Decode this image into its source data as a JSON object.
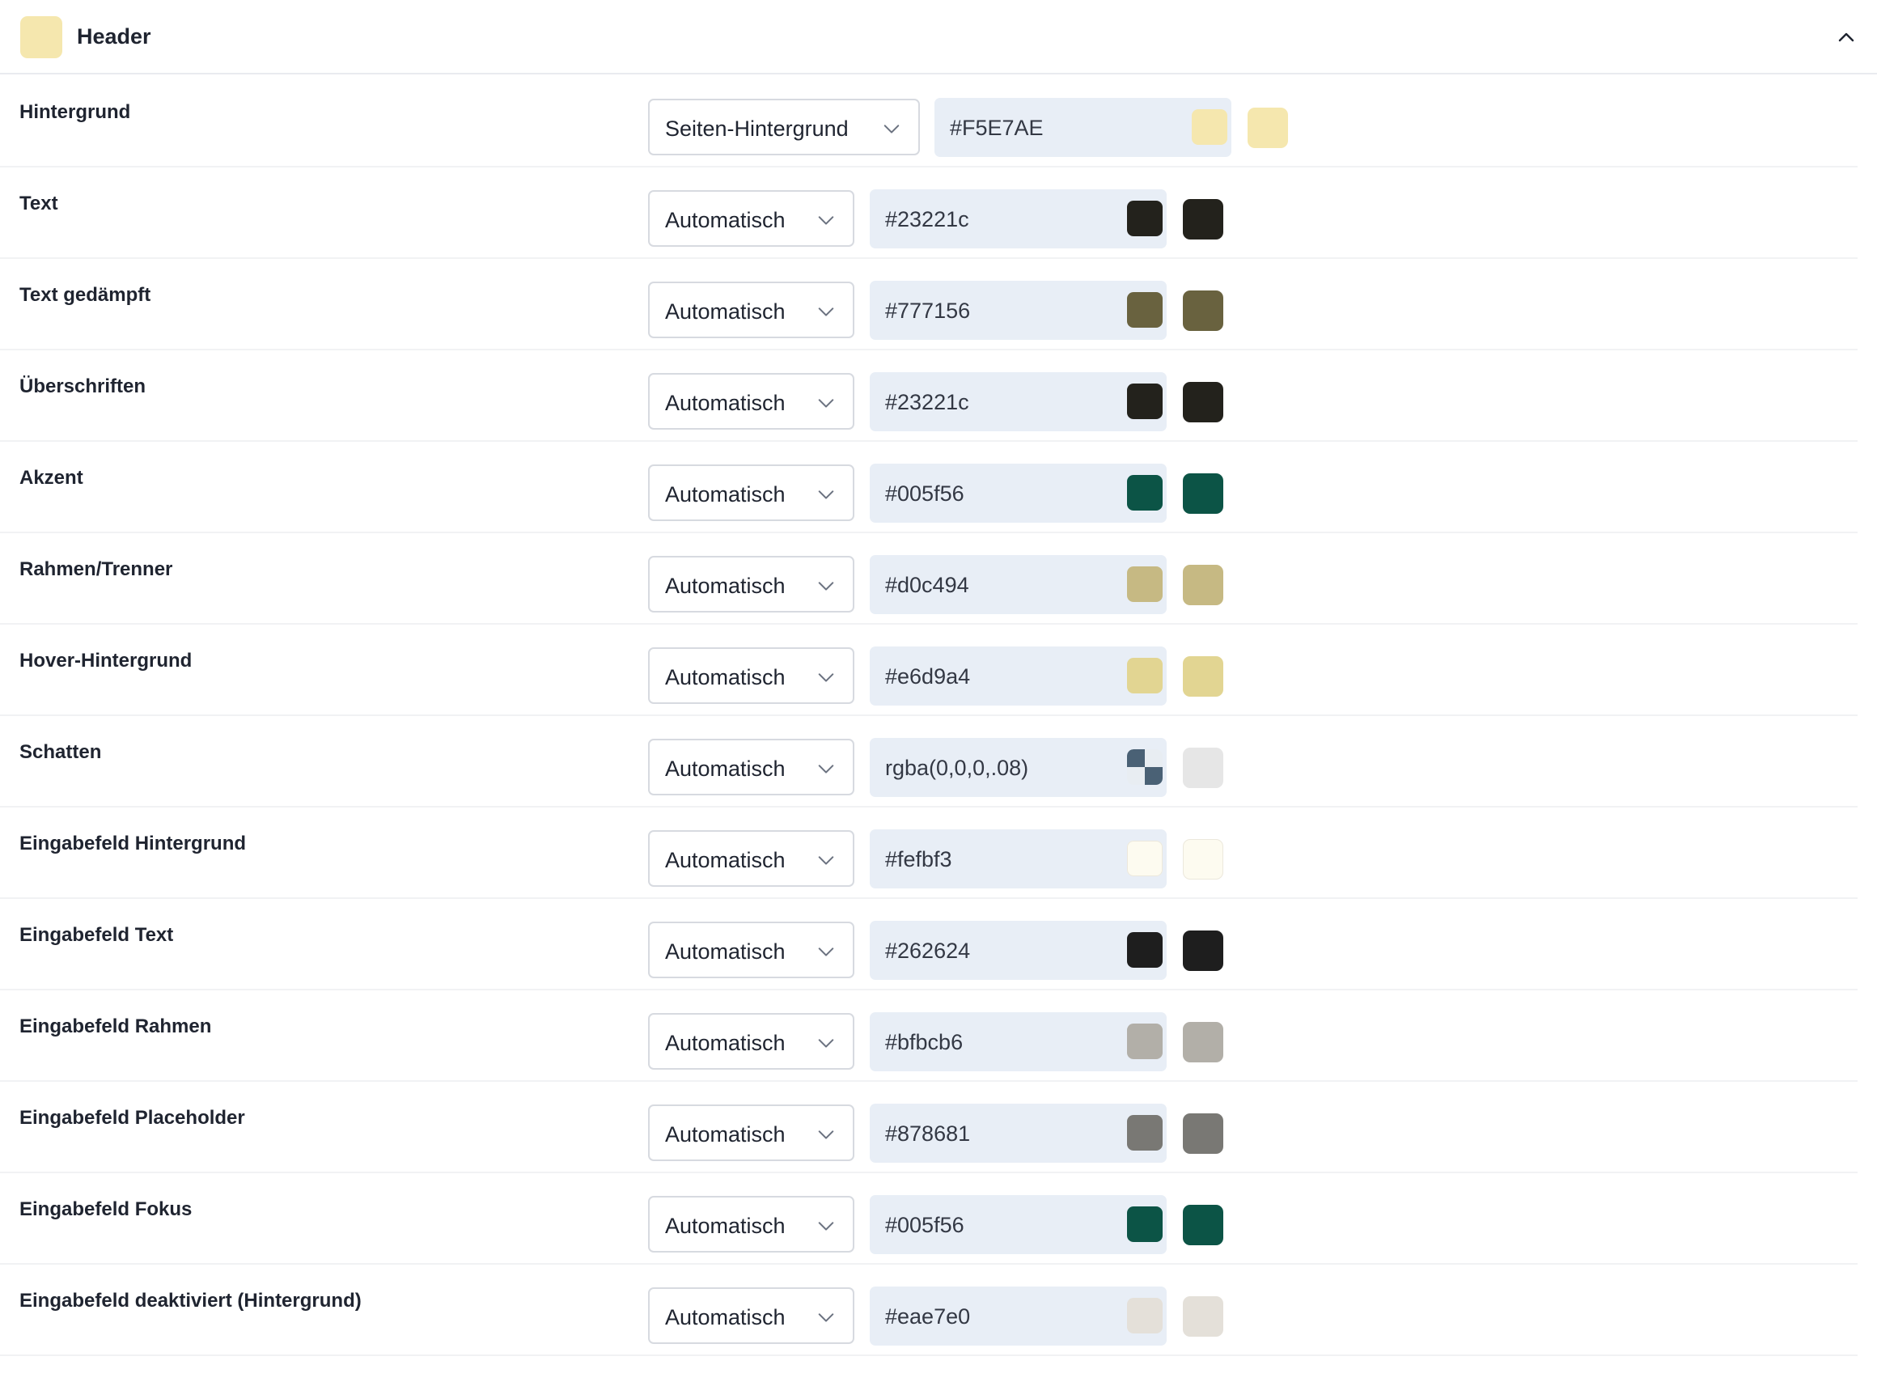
{
  "section": {
    "title": "Header",
    "swatch_color": "#F5E7AE",
    "collapse_icon": "chevron-up-icon"
  },
  "rows": [
    {
      "label": "Hintergrund",
      "mode": "Seiten-Hintergrund",
      "value": "#F5E7AE",
      "color": "#F5E7AE"
    },
    {
      "label": "Text",
      "mode": "Automatisch",
      "value": "#23221c",
      "color": "#23221c"
    },
    {
      "label": "Text gedämpft",
      "mode": "Automatisch",
      "value": "#777156",
      "color": "#69623f"
    },
    {
      "label": "Überschriften",
      "mode": "Automatisch",
      "value": "#23221c",
      "color": "#23221c"
    },
    {
      "label": "Akzent",
      "mode": "Automatisch",
      "value": "#005f56",
      "color": "#0c5446"
    },
    {
      "label": "Rahmen/Trenner",
      "mode": "Automatisch",
      "value": "#d0c494",
      "color": "#c6b983"
    },
    {
      "label": "Hover-Hintergrund",
      "mode": "Automatisch",
      "value": "#e6d9a4",
      "color": "#e2d592"
    },
    {
      "label": "Schatten",
      "mode": "Automatisch",
      "value": "rgba(0,0,0,.08)",
      "color": "#e6e6e6",
      "transparent": true
    },
    {
      "label": "Eingabefeld Hintergrund",
      "mode": "Automatisch",
      "value": "#fefbf3",
      "color": "#fdfbf0"
    },
    {
      "label": "Eingabefeld Text",
      "mode": "Automatisch",
      "value": "#262624",
      "color": "#1e1e1e"
    },
    {
      "label": "Eingabefeld Rahmen",
      "mode": "Automatisch",
      "value": "#bfbcb6",
      "color": "#b2afa8"
    },
    {
      "label": "Eingabefeld Placeholder",
      "mode": "Automatisch",
      "value": "#878681",
      "color": "#797874"
    },
    {
      "label": "Eingabefeld Fokus",
      "mode": "Automatisch",
      "value": "#005f56",
      "color": "#0c5446"
    },
    {
      "label": "Eingabefeld deaktiviert (Hintergrund)",
      "mode": "Automatisch",
      "value": "#eae7e0",
      "color": "#e4e0d9"
    }
  ]
}
